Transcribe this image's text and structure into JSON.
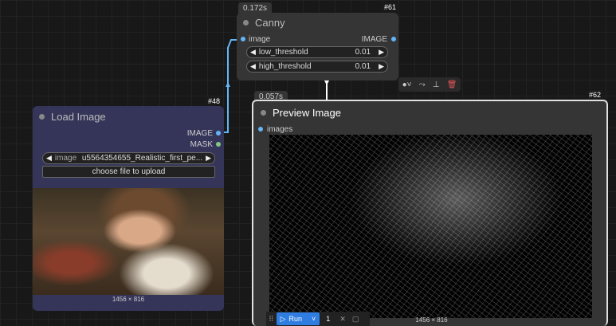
{
  "canny": {
    "timing": "0.172s",
    "id": "#61",
    "title": "Canny",
    "input_label": "image",
    "output_label": "IMAGE",
    "low_threshold": {
      "name": "low_threshold",
      "value": "0.01"
    },
    "high_threshold": {
      "name": "high_threshold",
      "value": "0.01"
    }
  },
  "load_image": {
    "id": "#48",
    "title": "Load Image",
    "output_image": "IMAGE",
    "output_mask": "MASK",
    "image_widget": {
      "name": "image",
      "value": "u5564354655_Realistic_first_pe..."
    },
    "upload_label": "choose file to upload",
    "dimensions": "1456 × 816"
  },
  "preview": {
    "timing": "0.057s",
    "id": "#62",
    "title": "Preview Image",
    "input_label": "images",
    "dimensions": "1456 × 816"
  },
  "run_bar": {
    "run_label": "Run",
    "count": "1"
  },
  "colors": {
    "image_port": "#64b5f6",
    "mask_port": "#81c784",
    "upload_port": "#8bc34a",
    "canny_bg": "#353535",
    "load_bg": "#35355a",
    "run_bg": "#2f7de1"
  }
}
